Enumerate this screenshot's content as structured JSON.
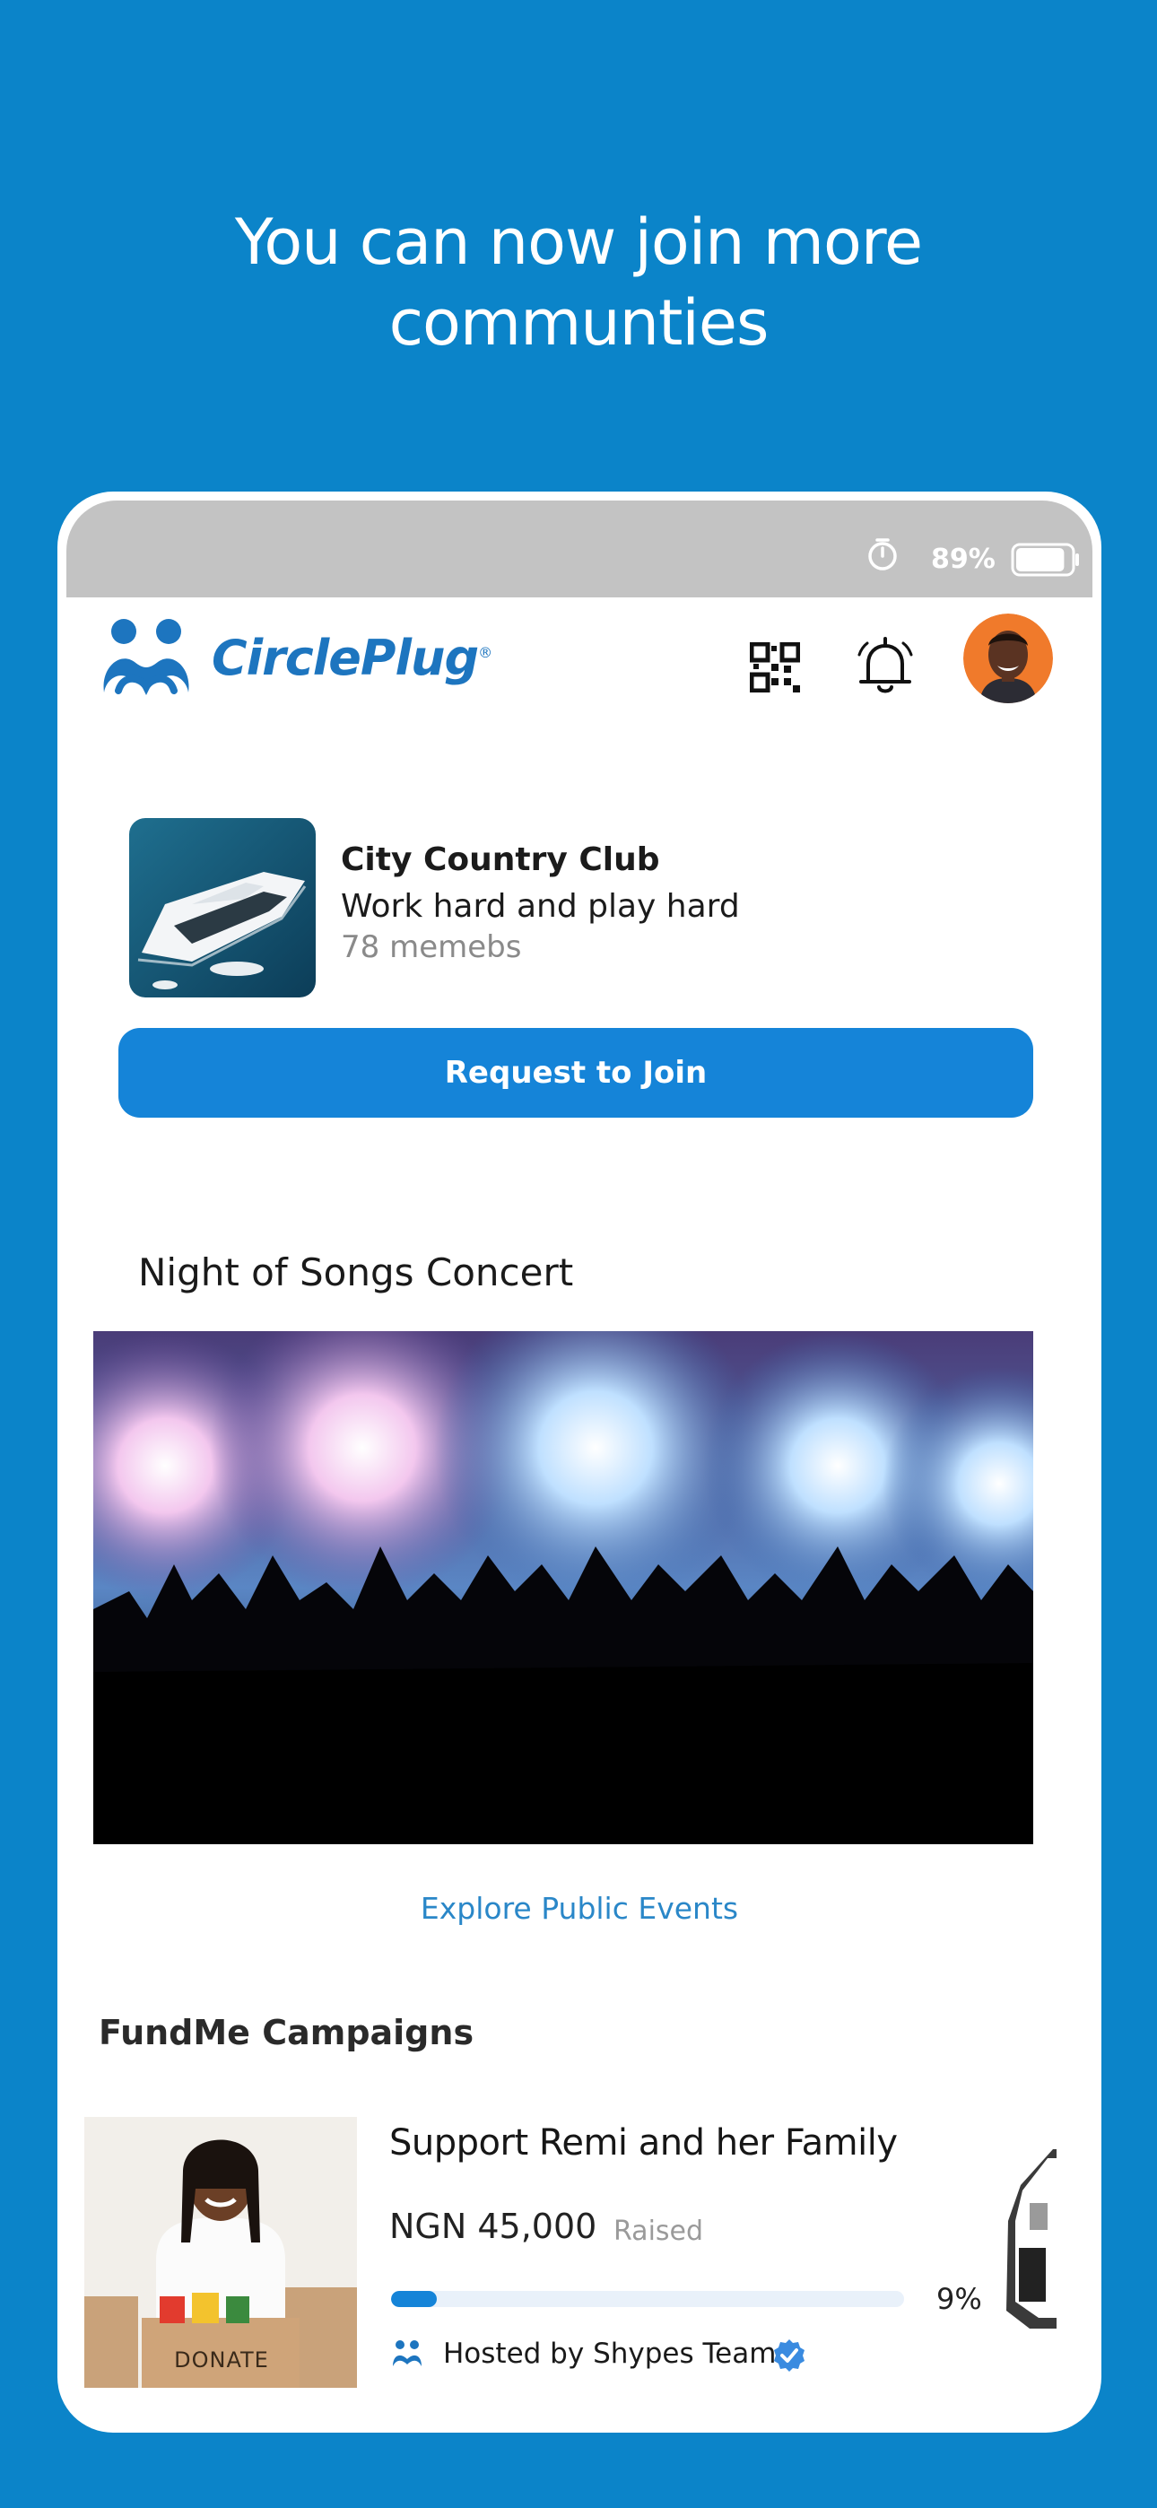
{
  "promo": {
    "line1": "You can now join more",
    "line2": "communties"
  },
  "status": {
    "battery_percent": "89%",
    "battery_level": 0.89,
    "icons": [
      "timer-icon",
      "battery-icon"
    ]
  },
  "header": {
    "brand_name": "CirclePlug",
    "brand_mark": "®",
    "icons": [
      "circleplug-logo-icon",
      "qr-code-icon",
      "bell-icon",
      "avatar"
    ]
  },
  "community": {
    "name": "City Country Club",
    "tagline": "Work hard and play hard",
    "members": "78 memebs",
    "join_label": "Request to Join"
  },
  "event": {
    "title": "Night of Songs Concert",
    "explore_label": "Explore Public Events"
  },
  "fundme": {
    "heading": "FundMe Campaigns",
    "campaigns": [
      {
        "title": "Support Remi and her Family",
        "amount": "NGN 45,000",
        "raised_label": "Raised",
        "progress_percent": 9,
        "progress_label": "9%",
        "host": "Hosted by Shypes Team",
        "image_caption": "DONATE"
      }
    ]
  },
  "colors": {
    "background": "#0b84c9",
    "accent": "#1584d8",
    "brand": "#1d75bf",
    "link": "#2a87c8"
  }
}
